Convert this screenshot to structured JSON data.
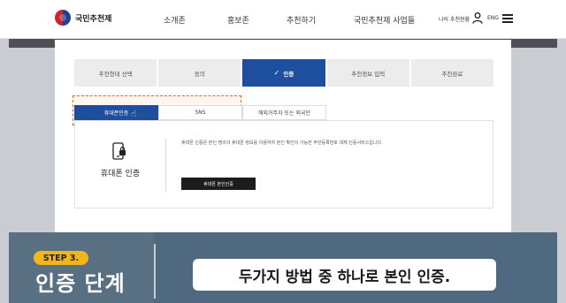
{
  "header": {
    "logo_text": "국민추천제",
    "nav": [
      "소개존",
      "홍보존",
      "추천하기",
      "국민추천제 사업들"
    ],
    "my_recommend": "나의 추천현황",
    "lang": "ENG"
  },
  "steps": [
    {
      "label": "추천형태 선택"
    },
    {
      "label": "동의"
    },
    {
      "label": "인증",
      "check": "✓"
    },
    {
      "label": "추천정보 입력"
    },
    {
      "label": "추천완료"
    }
  ],
  "subtabs": [
    "휴대폰인증",
    "SNS",
    "해외거주자 또는 외국인"
  ],
  "panel": {
    "title": "휴대폰 인증",
    "description": "휴대폰 인증은 본인 명의의 휴대폰 정보를 이용하여 본인 확인이 가능한 주민등록번호 대체 인증서비스입니다.",
    "button": "휴대폰 본인인증"
  },
  "caption": {
    "step_badge": "STEP 3.",
    "stage_title": "인증 단계",
    "text": "두가지 방법 중 하나로 본인 인증."
  },
  "colors": {
    "accent": "#1e4f9e",
    "badge": "#f2b51c",
    "highlight": "#e06a1a"
  }
}
